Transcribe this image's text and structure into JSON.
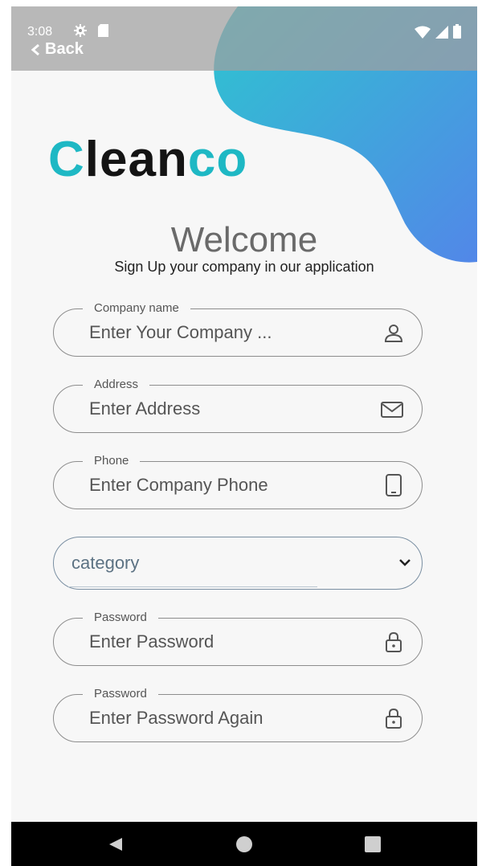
{
  "status_bar": {
    "time": "3:08",
    "icons": [
      "gear-icon",
      "sd-card-icon",
      "wifi-icon",
      "signal-icon",
      "battery-icon"
    ]
  },
  "back": {
    "label": "Back",
    "icon": "chevron-left-icon"
  },
  "logo": {
    "part1": "C",
    "part2": "lean",
    "part3": "co"
  },
  "welcome": {
    "title": "Welcome",
    "subtitle": "Sign Up your company in our application"
  },
  "form": {
    "company": {
      "label": "Company name",
      "placeholder": "Enter Your Company ...",
      "icon": "person-icon"
    },
    "address": {
      "label": "Address",
      "placeholder": "Enter Address",
      "icon": "mail-icon"
    },
    "phone": {
      "label": "Phone",
      "placeholder": "Enter Company Phone",
      "icon": "smartphone-icon"
    },
    "category": {
      "placeholder": "category",
      "icon": "chevron-down-icon"
    },
    "password": {
      "label": "Password",
      "placeholder": "Enter  Password",
      "icon": "lock-icon"
    },
    "password_again": {
      "label": "Password",
      "placeholder": "Enter Password Again",
      "icon": "lock-icon"
    }
  },
  "navigation": {
    "buttons": [
      "back-triangle-icon",
      "home-circle-icon",
      "recents-square-icon"
    ]
  },
  "colors": {
    "brand_teal": "#1eb8c4",
    "brand_dark": "#141414",
    "blob_start": "#2ec4d0",
    "blob_end": "#5287e8"
  }
}
